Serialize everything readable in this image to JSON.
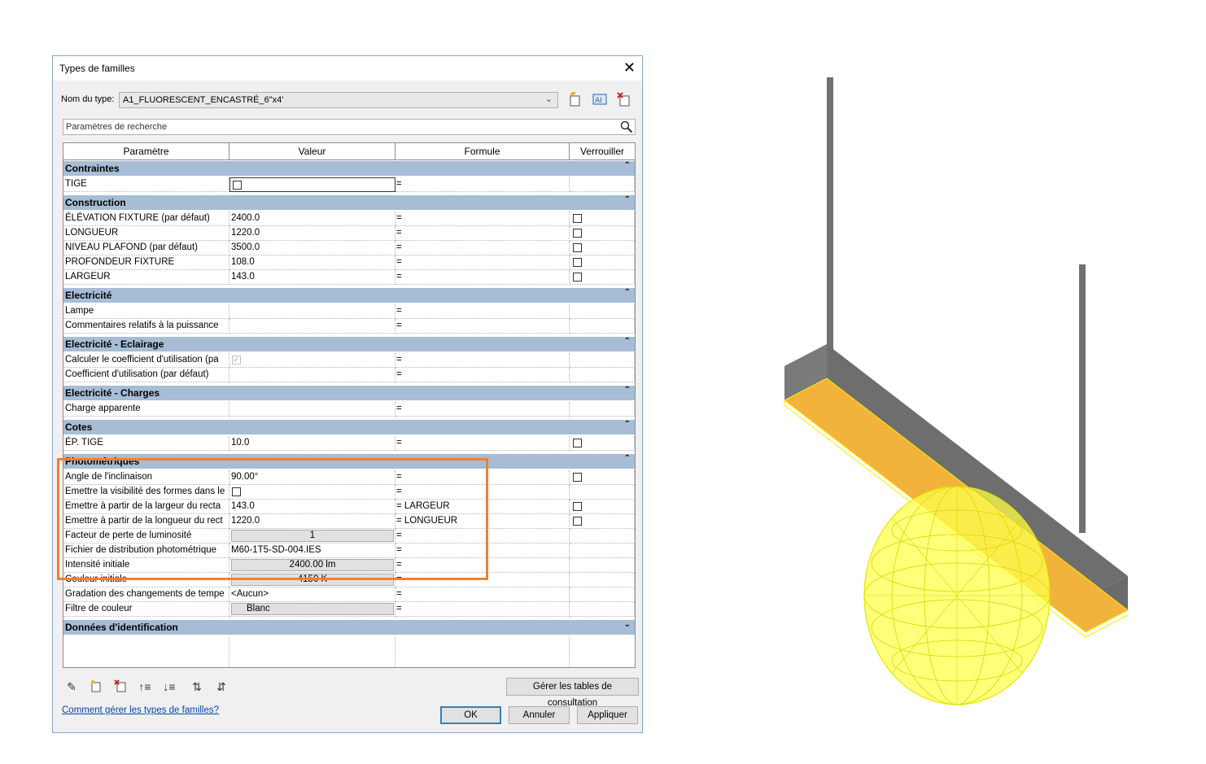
{
  "dialog": {
    "title": "Types de familles",
    "type_label": "Nom du type:",
    "type_value": "A1_FLUORESCENT_ENCASTRÉ_6\"x4'",
    "search_placeholder": "Paramètres de recherche",
    "columns": [
      "Paramètre",
      "Valeur",
      "Formule",
      "Verrouiller"
    ],
    "groups": [
      {
        "name": "Contraintes",
        "rows": [
          {
            "param": "TIGE",
            "value": "",
            "value_type": "checkbox-selected",
            "formula": "=",
            "lock": false
          }
        ]
      },
      {
        "name": "Construction",
        "rows": [
          {
            "param": "ÉLÉVATION FIXTURE (par défaut)",
            "value": "2400.0",
            "formula": "=",
            "lock": true
          },
          {
            "param": "LONGUEUR",
            "value": "1220.0",
            "formula": "=",
            "lock": true
          },
          {
            "param": "NIVEAU PLAFOND (par défaut)",
            "value": "3500.0",
            "formula": "=",
            "lock": true
          },
          {
            "param": "PROFONDEUR FIXTURE",
            "value": "108.0",
            "formula": "=",
            "lock": true
          },
          {
            "param": "LARGEUR",
            "value": "143.0",
            "formula": "=",
            "lock": true
          }
        ]
      },
      {
        "name": "Electricité",
        "rows": [
          {
            "param": "Lampe",
            "value": "",
            "formula": "=",
            "lock": false
          },
          {
            "param": "Commentaires relatifs à la puissance",
            "value": "",
            "formula": "=",
            "lock": false
          }
        ]
      },
      {
        "name": "Electricité - Eclairage",
        "rows": [
          {
            "param": "Calculer le coefficient d'utilisation (pa",
            "value": "",
            "value_type": "checkbox-checked",
            "formula": "=",
            "lock": false
          },
          {
            "param": "Coefficient d'utilisation (par défaut)",
            "value": "",
            "formula": "=",
            "lock": false
          }
        ]
      },
      {
        "name": "Electricité - Charges",
        "rows": [
          {
            "param": "Charge apparente",
            "value": "",
            "formula": "=",
            "lock": false
          }
        ]
      },
      {
        "name": "Cotes",
        "rows": [
          {
            "param": "ÉP. TIGE",
            "value": "10.0",
            "formula": "=",
            "lock": true
          }
        ]
      },
      {
        "name": "Photométriques",
        "rows": [
          {
            "param": "Angle de l'inclinaison",
            "value": "90.00°",
            "formula": "=",
            "lock": true
          },
          {
            "param": "Emettre la visibilité des formes dans le",
            "value": "",
            "value_type": "checkbox",
            "formula": "=",
            "lock": false
          },
          {
            "param": "Emettre à partir de la largeur du recta",
            "value": "143.0",
            "formula": "= LARGEUR",
            "lock": true
          },
          {
            "param": "Emettre à partir de la longueur du rect",
            "value": "1220.0",
            "formula": "= LONGUEUR",
            "lock": true
          },
          {
            "param": "Facteur de perte de luminosité",
            "value": "1",
            "value_type": "button",
            "formula": "=",
            "lock": false
          },
          {
            "param": "Fichier de distribution photométrique",
            "value": "M60-1T5-SD-004.IES",
            "formula": "=",
            "lock": false
          },
          {
            "param": "Intensité initiale",
            "value": "2400.00 lm",
            "value_type": "button",
            "formula": "=",
            "lock": false
          },
          {
            "param": "Couleur initiale",
            "value": "4150 K",
            "value_type": "button",
            "formula": "=",
            "lock": false
          },
          {
            "param": "Gradation des changements de tempe",
            "value": "<Aucun>",
            "formula": "=",
            "lock": false
          },
          {
            "param": "Filtre de couleur",
            "value": "Blanc",
            "value_type": "button-left",
            "formula": "=",
            "lock": false
          }
        ]
      },
      {
        "name": "Données d'identification",
        "collapsed": true,
        "rows": []
      }
    ],
    "lookup_button": "Gérer les tables de consultation",
    "help_link": "Comment gérer les types de familles?",
    "ok_label": "OK",
    "cancel_label": "Annuler",
    "apply_label": "Appliquer"
  },
  "colors": {
    "group_header": "#a7bdd6",
    "highlight": "#f08030",
    "fixture_light": "#f2b33d",
    "fixture_body": "#8a8a8a",
    "light_sphere": "#ffff00"
  }
}
